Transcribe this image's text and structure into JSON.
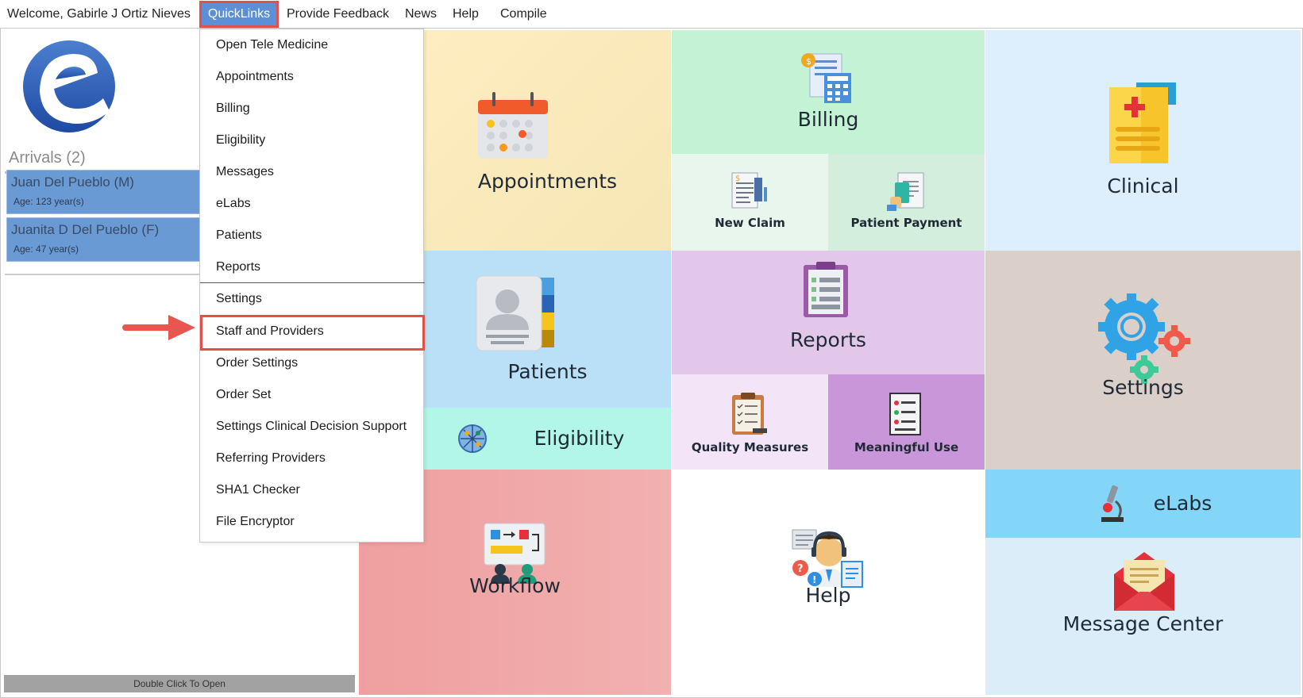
{
  "menubar": {
    "welcome": "Welcome, Gabirle J Ortiz Nieves",
    "quicklinks": "QuickLinks",
    "feedback": "Provide Feedback",
    "news": "News",
    "help": "Help",
    "compile": "Compile"
  },
  "left_panel": {
    "arrivals": "Arrivals (2)",
    "patients": [
      {
        "name": "Juan Del Pueblo (M)",
        "age": "Age: 123 year(s)"
      },
      {
        "name": "Juanita D Del Pueblo (F)",
        "age": "Age: 47 year(s)"
      }
    ],
    "double_click": "Double Click To Open"
  },
  "dropdown": {
    "items": [
      "Open Tele Medicine",
      "Appointments",
      "Billing",
      "Eligibility",
      "Messages",
      "eLabs",
      "Patients",
      "Reports",
      "Settings",
      "Staff and Providers",
      "Order Settings",
      "Order Set",
      "Settings Clinical Decision Support",
      "Referring Providers",
      "SHA1 Checker",
      "File Encryptor"
    ],
    "highlighted": "Staff and Providers"
  },
  "tiles": {
    "appointments": "Appointments",
    "billing": "Billing",
    "new_claim": "New Claim",
    "patient_payment": "Patient Payment",
    "clinical": "Clinical",
    "patients": "Patients",
    "eligibility": "Eligibility",
    "reports": "Reports",
    "quality_measures": "Quality Measures",
    "meaningful_use": "Meaningful Use",
    "settings": "Settings",
    "workflow": "Workflow",
    "help": "Help",
    "elabs": "eLabs",
    "message_center": "Message Center"
  },
  "colors": {
    "accent": "#5b8fd6",
    "highlight_border": "#e0514a",
    "patient_card": "#6a9ad3"
  },
  "icons": [
    "calendar-icon",
    "billing-icon",
    "new-claim-icon",
    "patient-payment-icon",
    "clinical-icon",
    "patients-icon",
    "eligibility-icon",
    "reports-icon",
    "quality-measures-icon",
    "meaningful-use-icon",
    "settings-icon",
    "workflow-icon",
    "help-icon",
    "elabs-icon",
    "message-center-icon",
    "logo-icon",
    "arrow-icon"
  ]
}
